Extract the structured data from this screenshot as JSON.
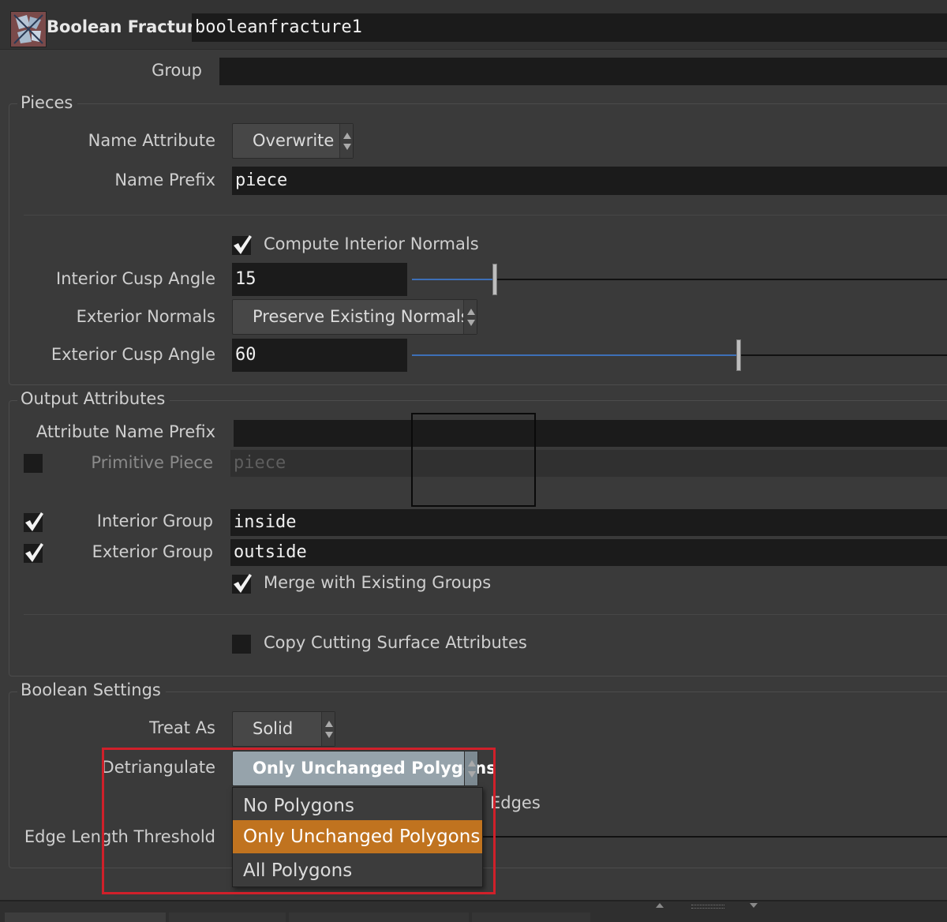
{
  "header": {
    "node_type": "Boolean Fracture",
    "node_name": "booleanfracture1"
  },
  "group": {
    "label": "Group",
    "value": ""
  },
  "pieces": {
    "title": "Pieces",
    "name_attribute": {
      "label": "Name Attribute",
      "value": "Overwrite"
    },
    "name_prefix": {
      "label": "Name Prefix",
      "value": "piece"
    },
    "compute_interior_normals": {
      "label": "Compute Interior Normals",
      "checked": true
    },
    "interior_cusp_angle": {
      "label": "Interior Cusp Angle",
      "value": "15",
      "slider_fraction": 0.15
    },
    "exterior_normals": {
      "label": "Exterior Normals",
      "value": "Preserve Existing Normals"
    },
    "exterior_cusp_angle": {
      "label": "Exterior Cusp Angle",
      "value": "60",
      "slider_fraction": 0.6
    }
  },
  "output_attributes": {
    "title": "Output Attributes",
    "attribute_name_prefix": {
      "label": "Attribute Name Prefix",
      "value": ""
    },
    "primitive_piece": {
      "label": "Primitive Piece",
      "value": "piece",
      "checked": false
    },
    "interior_group": {
      "label": "Interior Group",
      "value": "inside",
      "checked": true
    },
    "exterior_group": {
      "label": "Exterior Group",
      "value": "outside",
      "checked": true
    },
    "merge_existing_groups": {
      "label": "Merge with Existing Groups",
      "checked": true
    },
    "copy_cutting_surface": {
      "label": "Copy Cutting Surface Attributes",
      "checked": false
    }
  },
  "boolean_settings": {
    "title": "Boolean Settings",
    "treat_as": {
      "label": "Treat As",
      "value": "Solid"
    },
    "detriangulate": {
      "label": "Detriangulate",
      "value": "Only Unchanged Polygons",
      "options": [
        "No Polygons",
        "Only Unchanged Polygons",
        "All Polygons"
      ],
      "selected_index": 1
    },
    "hidden_row_tail": "Edges",
    "edge_length_threshold": {
      "label": "Edge Length Threshold"
    }
  },
  "colors": {
    "background": "#3a3a3a",
    "field": "#1b1b1b",
    "highlight": "#c0731f",
    "annotation_red": "#d0202a",
    "slider_fill": "#3d6fb7"
  }
}
